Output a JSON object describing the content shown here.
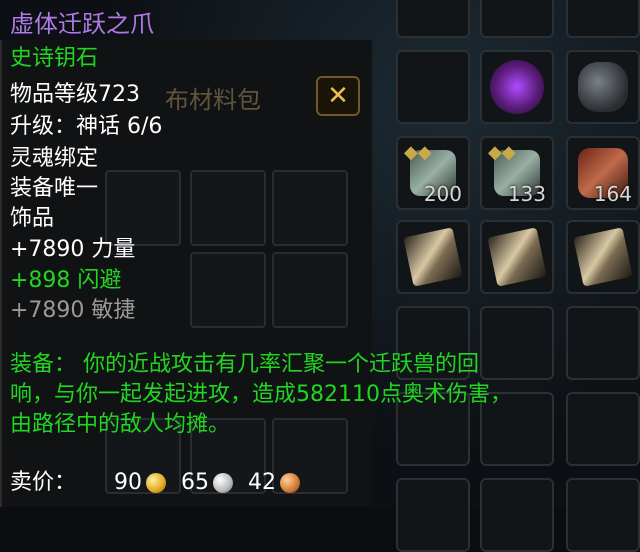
{
  "bag": {
    "title": "布材料包",
    "close_icon": "close-icon",
    "slot_counts": [
      "200",
      "133",
      "164"
    ]
  },
  "tooltip": {
    "item_name": "虚体迁跃之爪",
    "quality": "史诗钥石",
    "item_level": "物品等级723",
    "upgrade": "升级：神话 6/6",
    "bind": "灵魂绑定",
    "unique": "装备唯一",
    "slot_type": "饰品",
    "stat_strength": "+7890 力量",
    "stat_dodge": "+898 闪避",
    "stat_agility": "+7890 敏捷",
    "equip_line1": "装备：  你的近战攻击有几率汇聚一个迁跃兽的回",
    "equip_line2": "响，与你一起发起进攻，造成582110点奥术伤害，",
    "equip_line3": "由路径中的敌人均摊。",
    "sell_label": "卖价：",
    "sell_gold": "90",
    "sell_silver": "65",
    "sell_copper": "42"
  },
  "colors": {
    "epic": "#b07ae6",
    "bonus": "#21d621",
    "inactive": "#9a9a9a"
  }
}
